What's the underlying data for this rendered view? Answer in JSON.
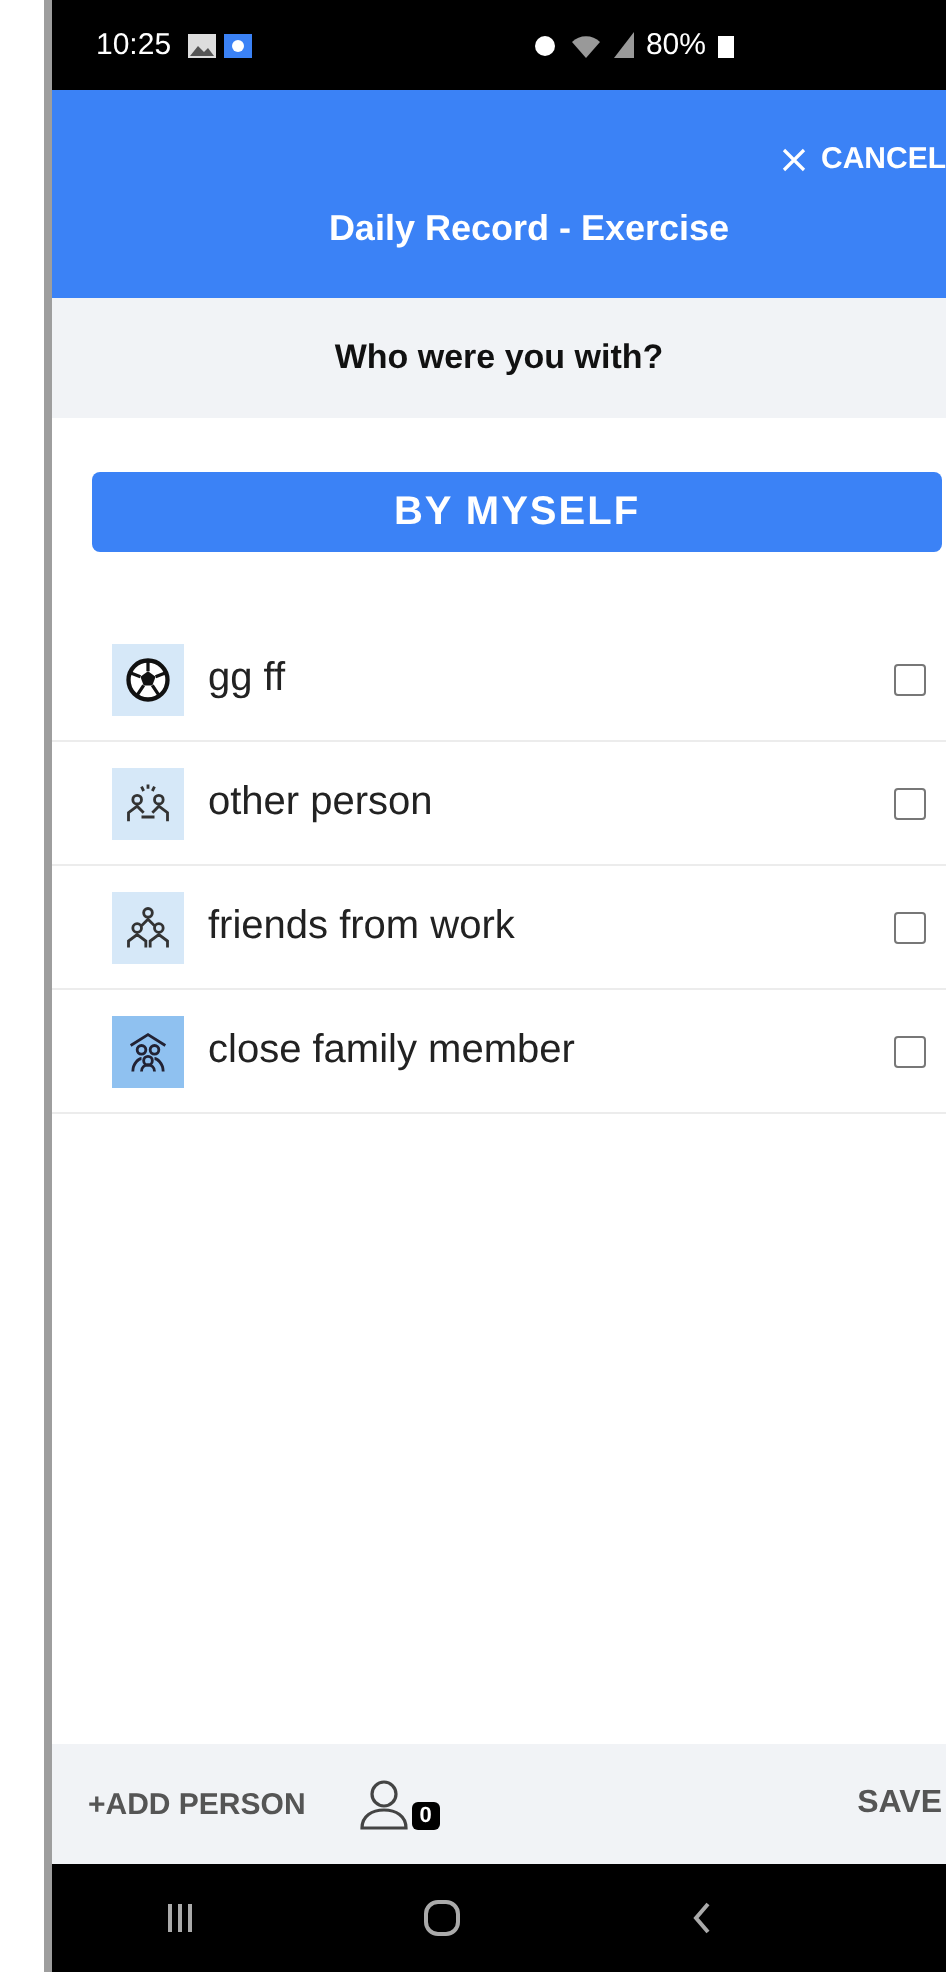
{
  "status_bar": {
    "time": "10:25",
    "battery": "80%"
  },
  "header": {
    "cancel": "CANCEL",
    "title": "Daily Record - Exercise"
  },
  "question": "Who were you with?",
  "by_myself_button": "BY MYSELF",
  "people": [
    {
      "label": "gg ff",
      "checked": false
    },
    {
      "label": "other person",
      "checked": false
    },
    {
      "label": "friends from work",
      "checked": false
    },
    {
      "label": "close family member",
      "checked": false
    }
  ],
  "footer": {
    "add_person": "+ADD PERSON",
    "count": "0",
    "save": "SAVE"
  }
}
